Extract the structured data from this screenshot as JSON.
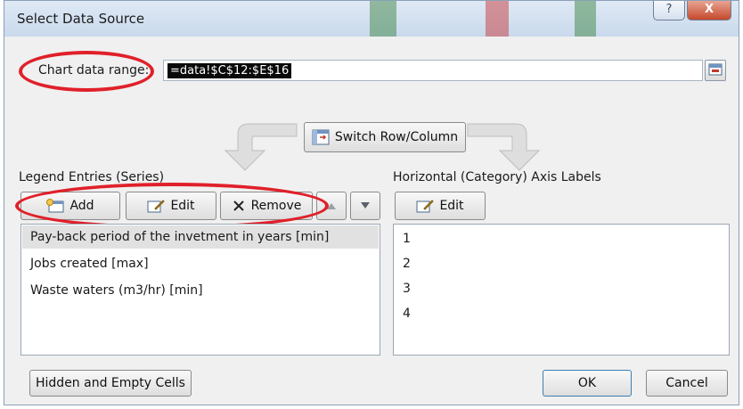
{
  "dialog": {
    "title": "Select Data Source",
    "help_label": "?",
    "close_label": "X"
  },
  "chart_range": {
    "label": "Chart data range:",
    "value": "=data!$C$12:$E$16"
  },
  "switch_button": {
    "label": "Switch Row/Column"
  },
  "legend": {
    "heading": "Legend Entries (Series)",
    "add_label": "Add",
    "edit_label": "Edit",
    "remove_label": "Remove",
    "items": [
      {
        "label": "Pay-back period of the invetment in years [min]",
        "selected": true
      },
      {
        "label": "Jobs created [max]",
        "selected": false
      },
      {
        "label": "Waste waters (m3/hr) [min]",
        "selected": false
      }
    ]
  },
  "axis": {
    "heading": "Horizontal (Category) Axis Labels",
    "edit_label": "Edit",
    "items": [
      "1",
      "2",
      "3",
      "4"
    ]
  },
  "footer": {
    "hidden_cells_label": "Hidden and Empty Cells",
    "ok_label": "OK",
    "cancel_label": "Cancel"
  },
  "colors": {
    "annotation": "#e0202a",
    "selection_bg": "#0a0a0a",
    "close_button": "#c5492c"
  },
  "icons": [
    "range-collapse-icon",
    "switch-icon",
    "add-series-icon",
    "edit-icon",
    "remove-x-icon",
    "move-up-icon",
    "move-down-icon",
    "curved-arrow-left-icon",
    "curved-arrow-right-icon"
  ]
}
